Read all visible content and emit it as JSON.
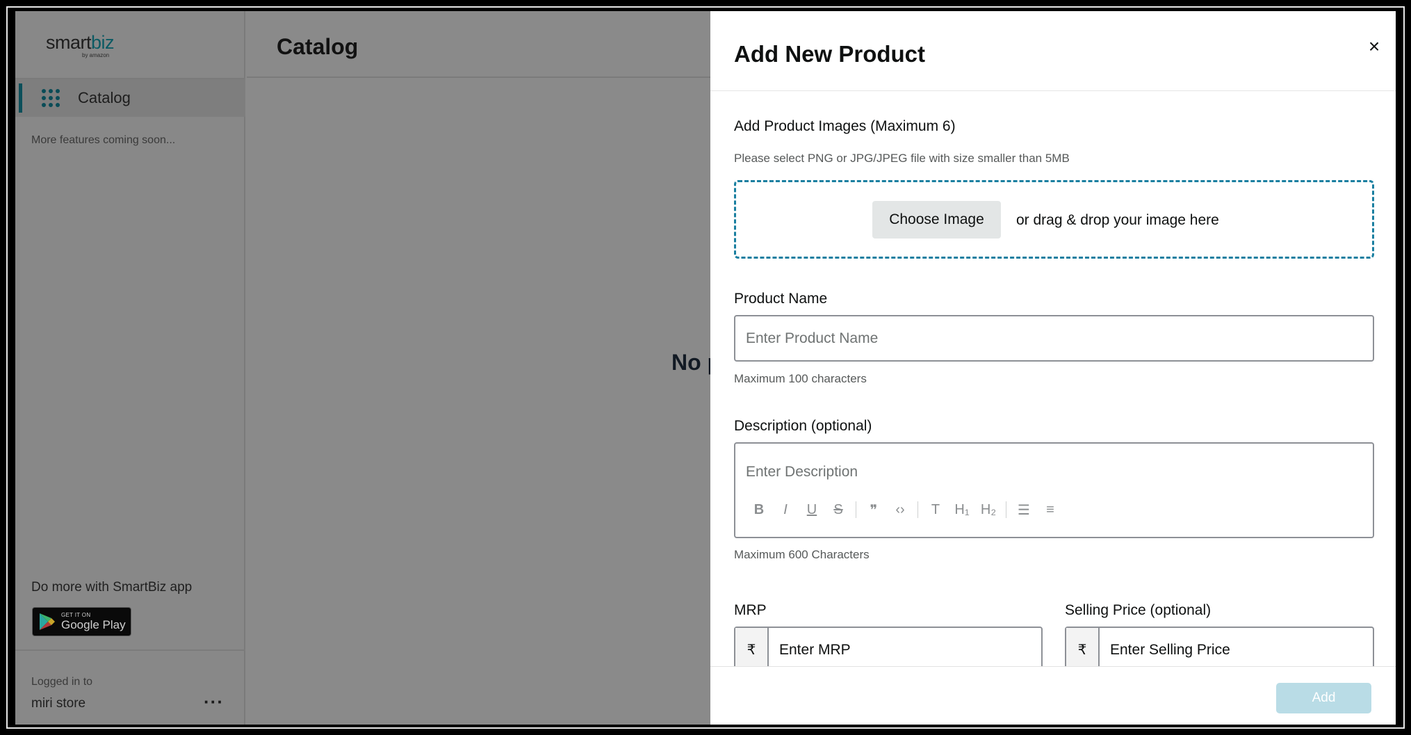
{
  "sidebar": {
    "brand_name_a": "smart",
    "brand_name_b": "biz",
    "brand_sub": "by amazon",
    "nav_label": "Catalog",
    "coming_soon": "More features coming soon...",
    "promo_text": "Do more with SmartBiz app",
    "gplay_small": "GET IT ON",
    "gplay_big": "Google Play",
    "logged_in_label": "Logged in to",
    "store_name": "miri store",
    "more_menu": "···"
  },
  "main": {
    "title": "Catalog",
    "empty_text_visible": "No p"
  },
  "drawer": {
    "title": "Add New Product",
    "close_glyph": "×",
    "images": {
      "label": "Add Product Images (Maximum 6)",
      "hint": "Please select PNG or JPG/JPEG file with size smaller than 5MB",
      "choose_button": "Choose Image",
      "drop_text": "or drag & drop your image here"
    },
    "product_name": {
      "label": "Product Name",
      "placeholder": "Enter Product Name",
      "hint": "Maximum 100 characters"
    },
    "description": {
      "label": "Description (optional)",
      "placeholder": "Enter Description",
      "hint": "Maximum 600 Characters",
      "toolbar": [
        "B",
        "I",
        "U",
        "S",
        "❞",
        "‹›",
        "T",
        "H₁",
        "H₂",
        "☰",
        "≡"
      ]
    },
    "mrp": {
      "label": "MRP",
      "currency": "₹",
      "placeholder": "Enter MRP"
    },
    "selling_price": {
      "label": "Selling Price (optional)",
      "currency": "₹",
      "placeholder": "Enter Selling Price"
    },
    "submit_label": "Add"
  },
  "colors": {
    "accent": "#1a7fa0",
    "brand_teal": "#0b4f5a",
    "disabled_button": "#b9dce6"
  }
}
